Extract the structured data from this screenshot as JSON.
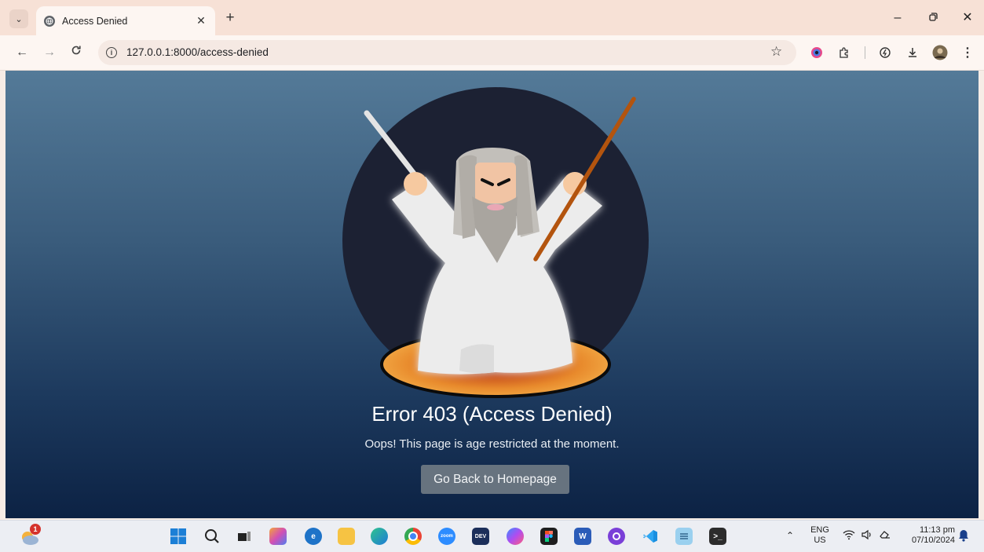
{
  "browser": {
    "tab": {
      "title": "Access Denied"
    },
    "address_bar": {
      "url": "127.0.0.1:8000/access-denied"
    }
  },
  "page": {
    "heading": "Error 403 (Access Denied)",
    "message": "Oops! This page is age restricted at the moment.",
    "home_button": "Go Back to Homepage"
  },
  "taskbar": {
    "notification_count": "1",
    "language": "ENG",
    "region": "US",
    "time": "11:13 pm",
    "date": "07/10/2024",
    "apps": [
      "windows-start",
      "search",
      "task-view",
      "copilot",
      "edge-beta",
      "file-explorer",
      "edge",
      "chrome",
      "zoom",
      "dev-home",
      "messenger",
      "figma",
      "word",
      "github-desktop",
      "vscode",
      "notepad",
      "terminal"
    ]
  },
  "colors": {
    "tab_strip": "#f7e1d6",
    "page_top": "#547a98",
    "page_bottom": "#0c2244",
    "button": "#67737f"
  }
}
